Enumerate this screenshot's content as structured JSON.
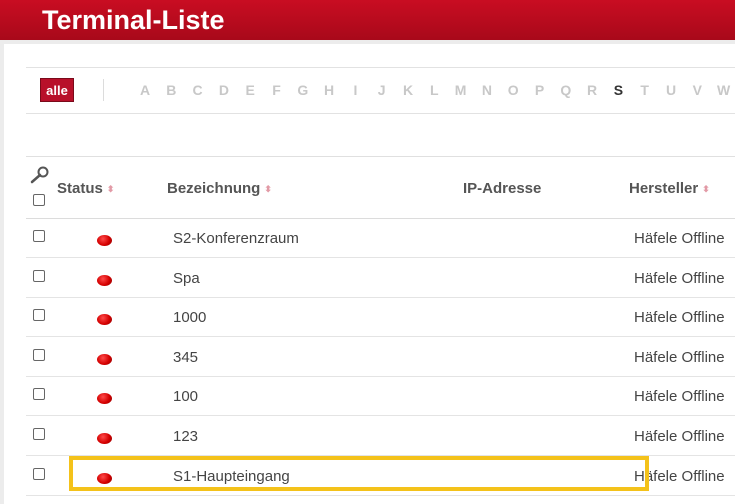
{
  "header": {
    "title": "Terminal-Liste"
  },
  "filter": {
    "all_label": "alle",
    "letters": [
      "A",
      "B",
      "C",
      "D",
      "E",
      "F",
      "G",
      "H",
      "I",
      "J",
      "K",
      "L",
      "M",
      "N",
      "O",
      "P",
      "Q",
      "R",
      "S",
      "T",
      "U",
      "V",
      "W"
    ],
    "active_letter": "S"
  },
  "table": {
    "columns": {
      "status": "Status",
      "name": "Bezeichnung",
      "ip": "IP-Adresse",
      "vendor": "Hersteller"
    },
    "sort_glyph": "⬍",
    "rows": [
      {
        "name": "S2-Konferenzraum",
        "ip": "",
        "vendor": "Häfele Offline",
        "status_color": "#d40000"
      },
      {
        "name": "Spa",
        "ip": "",
        "vendor": "Häfele Offline",
        "status_color": "#d40000"
      },
      {
        "name": "1000",
        "ip": "",
        "vendor": "Häfele Offline",
        "status_color": "#d40000"
      },
      {
        "name": "345",
        "ip": "",
        "vendor": "Häfele Offline",
        "status_color": "#d40000"
      },
      {
        "name": "100",
        "ip": "",
        "vendor": "Häfele Offline",
        "status_color": "#d40000"
      },
      {
        "name": "123",
        "ip": "",
        "vendor": "Häfele Offline",
        "status_color": "#d40000"
      },
      {
        "name": "S1-Haupteingang",
        "ip": "",
        "vendor": "Häfele Offline",
        "status_color": "#d40000"
      }
    ]
  },
  "colors": {
    "brand": "#b8102a",
    "highlight": "#f4c21a",
    "status_offline": "#d40000"
  }
}
